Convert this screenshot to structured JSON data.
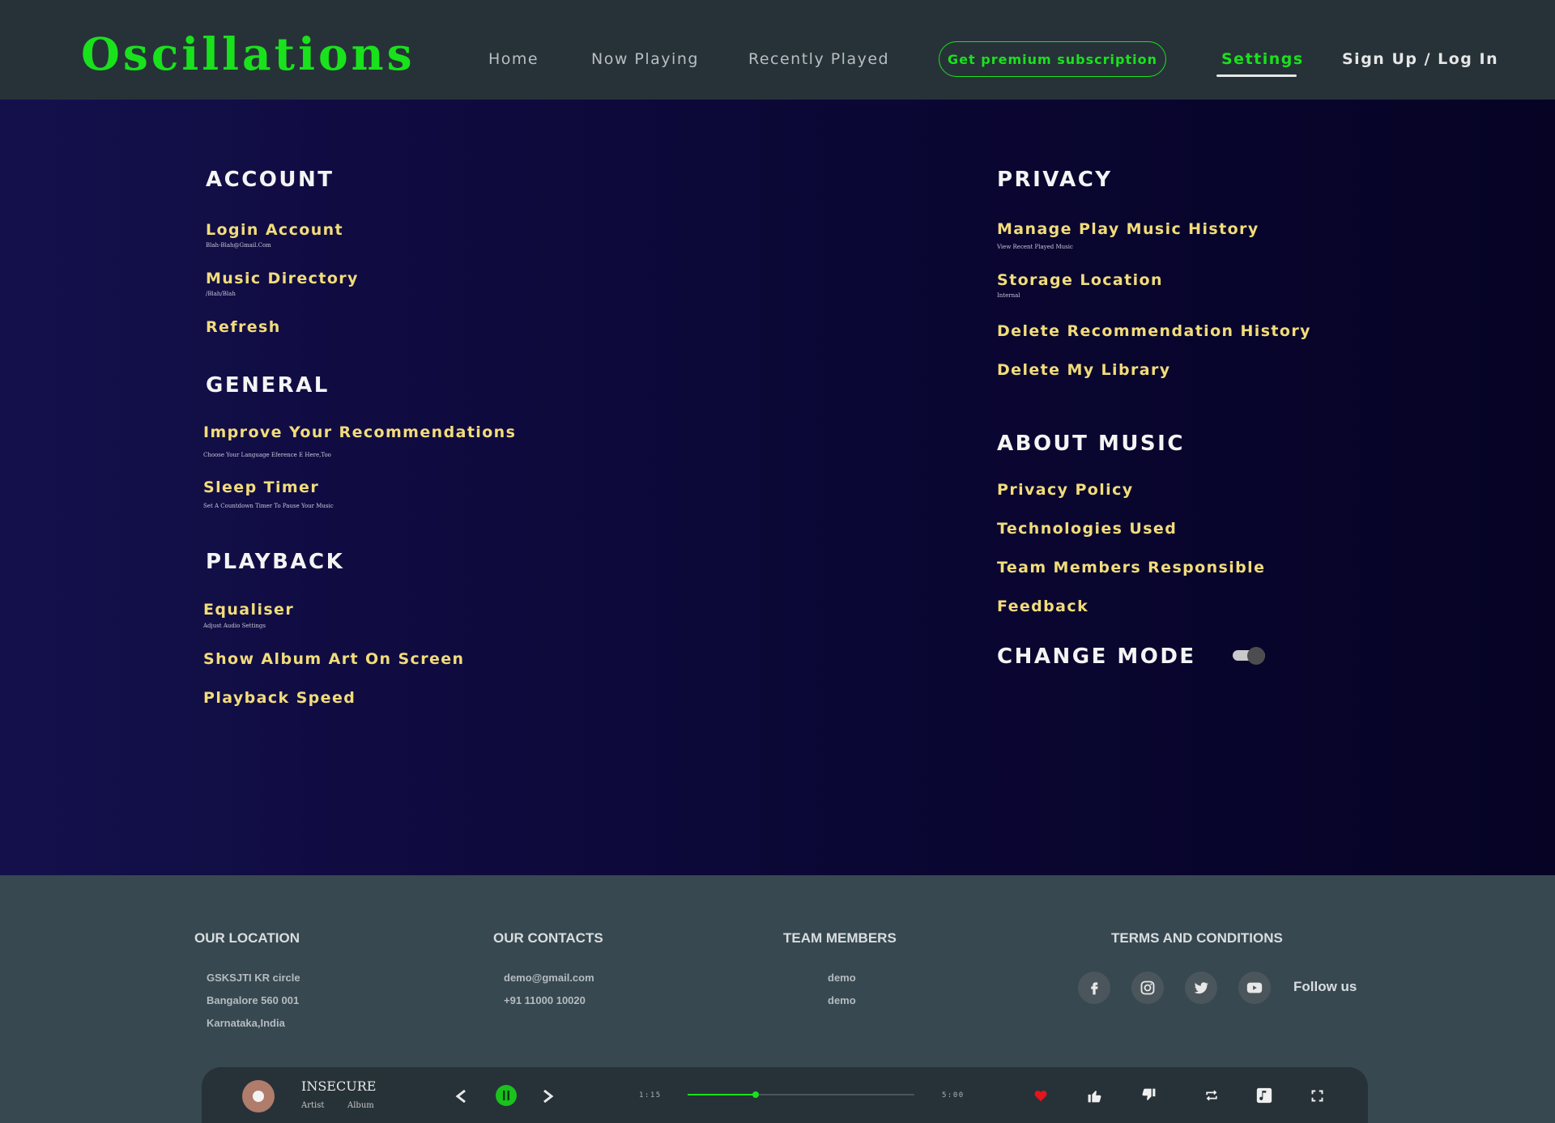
{
  "app": {
    "logo": "Oscillations",
    "brand_color": "#19e21c",
    "accent_text_color": "#f2dc7a"
  },
  "nav": {
    "home": "Home",
    "now_playing": "Now Playing",
    "recently_played": "Recently Played",
    "premium": "Get premium subscription",
    "settings": "Settings",
    "signup": "Sign Up / Log In",
    "active": "Settings"
  },
  "settings": {
    "account": {
      "title": "ACCOUNT",
      "login": "Login Account",
      "login_sub": "Blah-Blah@Gmail.Com",
      "music_dir": "Music Directory",
      "music_dir_sub": "/Blah/Blah",
      "refresh": "Refresh"
    },
    "general": {
      "title": "GENERAL",
      "improve": "Improve Your Recommendations",
      "improve_sub": "Choose Your Language Eference E Here,Too",
      "sleep": "Sleep Timer",
      "sleep_sub": "Set A Countdown Timer To Pause Your Music"
    },
    "playback": {
      "title": "PLAYBACK",
      "equaliser": "Equaliser",
      "equaliser_sub": "Adjust Audio Settings",
      "album_art": "Show Album Art On Screen",
      "speed": "Playback Speed"
    },
    "privacy": {
      "title": "PRIVACY",
      "history": "Manage Play Music History",
      "history_sub": "View Recent Played Music",
      "storage": "Storage Location",
      "storage_sub": "Internal",
      "delete_rec": "Delete Recommendation History",
      "delete_lib": "Delete My Library"
    },
    "about": {
      "title": "ABOUT MUSIC",
      "privacy_policy": "Privacy Policy",
      "tech": "Technologies Used",
      "team": "Team Members Responsible",
      "feedback": "Feedback"
    },
    "mode": {
      "title": "CHANGE MODE",
      "toggle_on": false
    }
  },
  "footer": {
    "location": {
      "title": "OUR LOCATION",
      "lines": [
        "GSKSJTI KR circle",
        "Bangalore 560 001",
        "Karnataka,India"
      ]
    },
    "contacts": {
      "title": "OUR CONTACTS",
      "email": "demo@gmail.com",
      "phone": "+91 11000 10020"
    },
    "team": {
      "title": "TEAM MEMBERS",
      "members": [
        "demo",
        "demo"
      ]
    },
    "terms": {
      "title": "TERMS AND CONDITIONS"
    },
    "social": {
      "icons": [
        "facebook-icon",
        "instagram-icon",
        "twitter-icon",
        "youtube-icon"
      ],
      "follow": "Follow us"
    }
  },
  "player": {
    "song": "INSECURE",
    "artist": "Artist",
    "album": "Album",
    "current_time": "1:15",
    "total_time": "5:00",
    "progress": 0.3,
    "liked": true
  }
}
